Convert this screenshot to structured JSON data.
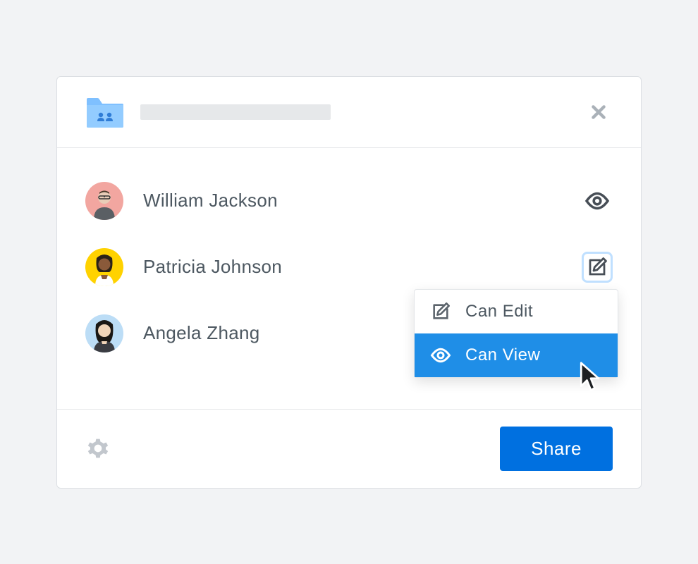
{
  "header": {
    "icon": "shared-folder-icon"
  },
  "members": [
    {
      "name": "William Jackson",
      "avatar_bg": "#f2a6a0",
      "permission": "view"
    },
    {
      "name": "Patricia Johnson",
      "avatar_bg": "#ffd200",
      "permission": "edit"
    },
    {
      "name": "Angela Zhang",
      "avatar_bg": "#bcddf6",
      "permission": "view"
    }
  ],
  "dropdown": {
    "options": [
      {
        "label": "Can Edit",
        "value": "edit"
      },
      {
        "label": "Can View",
        "value": "view"
      }
    ],
    "selected": "view"
  },
  "footer": {
    "share_label": "Share"
  }
}
